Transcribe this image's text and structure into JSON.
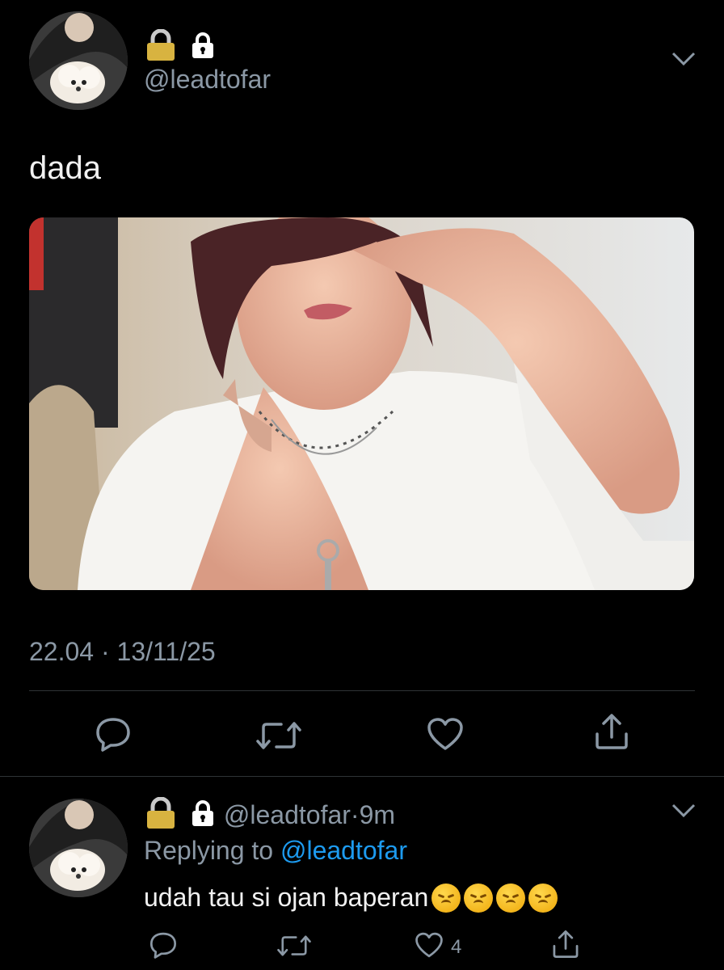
{
  "tweet": {
    "handle": "@leadtofar",
    "lock_icons": [
      "padlock-emoji-icon",
      "lock-icon"
    ],
    "text": "dada",
    "time": "22.04",
    "date": "13/11/25",
    "separator": "·"
  },
  "actions": [
    "reply-icon",
    "retweet-icon",
    "like-icon",
    "share-icon"
  ],
  "reply": {
    "handle": "@leadtofar",
    "age": "9m",
    "separator": "·",
    "replying_to_label": "Replying to",
    "replying_to_handle": "@leadtofar",
    "text": "udah tau si ojan baperan",
    "emojis": [
      "disappointed-face",
      "disappointed-face",
      "disappointed-face",
      "disappointed-face"
    ],
    "like_count": "4"
  },
  "colors": {
    "background": "#000000",
    "secondary_text": "#8b98a5",
    "link": "#1d9bf0",
    "divider": "#2f3336"
  }
}
